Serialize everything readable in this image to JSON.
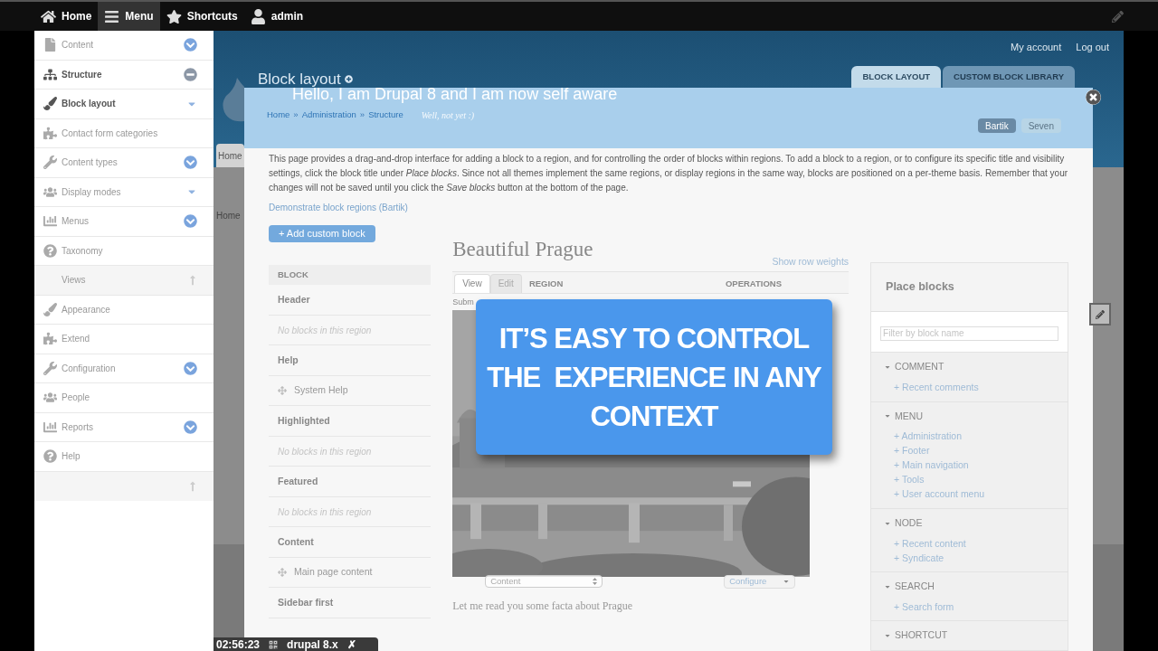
{
  "toolbar": {
    "items": [
      {
        "label": "Home",
        "selected": false
      },
      {
        "label": "Menu",
        "selected": true
      },
      {
        "label": "Shortcuts",
        "selected": false
      },
      {
        "label": "admin",
        "selected": false
      }
    ]
  },
  "sidebar": {
    "items": [
      {
        "label": "Content",
        "selected": false,
        "kind": "circle",
        "expanded": false
      },
      {
        "label": "Structure",
        "selected": true,
        "kind": "circle",
        "expanded": true
      },
      {
        "label": "Block layout",
        "selected": true,
        "kind": "caret",
        "expanded": false
      },
      {
        "label": "Contact form categories",
        "selected": false,
        "kind": "plain"
      },
      {
        "label": "Content types",
        "selected": false,
        "kind": "circle",
        "expanded": false
      },
      {
        "label": "Display modes",
        "selected": false,
        "kind": "caret",
        "expanded": false
      },
      {
        "label": "Menus",
        "selected": false,
        "kind": "circle",
        "expanded": false
      },
      {
        "label": "Taxonomy",
        "selected": false,
        "kind": "plain"
      },
      {
        "label": "Views",
        "selected": false,
        "kind": "up"
      },
      {
        "label": "Appearance",
        "selected": false,
        "kind": "plain"
      },
      {
        "label": "Extend",
        "selected": false,
        "kind": "plain"
      },
      {
        "label": "Configuration",
        "selected": false,
        "kind": "circle",
        "expanded": false
      },
      {
        "label": "People",
        "selected": false,
        "kind": "plain"
      },
      {
        "label": "Reports",
        "selected": false,
        "kind": "circle",
        "expanded": false
      },
      {
        "label": "Help",
        "selected": false,
        "kind": "plain"
      }
    ]
  },
  "header": {
    "account_links": [
      "My account",
      "Log out"
    ],
    "page_title": "Block layout",
    "tabs": [
      {
        "label": "BLOCK LAYOUT",
        "selected": true
      },
      {
        "label": "CUSTOM BLOCK LIBRARY",
        "selected": false
      }
    ],
    "home_tab": "Home",
    "breadcrumb_home": "Home"
  },
  "modal": {
    "title": "Hello, I am Drupal 8 and I am now self aware",
    "subtitle": "Well, not yet :)",
    "breadcrumb": [
      "Home",
      "Administration",
      "Structure"
    ],
    "separator": "»",
    "theme_tabs": [
      {
        "label": "Bartik",
        "selected": true
      },
      {
        "label": "Seven",
        "selected": false
      }
    ],
    "description": "This page provides a drag-and-drop interface for adding a block to a region, and for controlling the order of blocks within regions. To add a block to a region, or to configure its specific title and visibility settings, click the block title under *Place blocks*. Since not all themes implement the same regions, or display regions in the same way, blocks are positioned on a per-theme basis. Remember that your changes will not be saved until you click the *Save blocks* button at the bottom of the page.",
    "demo_link": "Demonstrate block regions (Bartik)",
    "add_button": "+ Add custom block"
  },
  "block_table": {
    "header": "BLOCK",
    "rows": [
      {
        "kind": "region",
        "text": "Header"
      },
      {
        "kind": "empty",
        "text": "No blocks in this region"
      },
      {
        "kind": "region",
        "text": "Help"
      },
      {
        "kind": "block",
        "text": "System Help"
      },
      {
        "kind": "region",
        "text": "Highlighted"
      },
      {
        "kind": "empty",
        "text": "No blocks in this region"
      },
      {
        "kind": "region",
        "text": "Featured"
      },
      {
        "kind": "empty",
        "text": "No blocks in this region"
      },
      {
        "kind": "region",
        "text": "Content"
      },
      {
        "kind": "block",
        "text": "Main page content"
      },
      {
        "kind": "region",
        "text": "Sidebar first"
      }
    ]
  },
  "preview": {
    "title": "Beautiful Prague",
    "weights_link": "Show row weights",
    "tabs": [
      {
        "label": "View",
        "selected": true
      },
      {
        "label": "Edit",
        "selected": false
      }
    ],
    "columns": [
      "REGION",
      "OPERATIONS"
    ],
    "cut_text": "Subm",
    "region_select": "Content",
    "configure_button": "Configure",
    "body": "Let me read you some facta about Prague"
  },
  "place_blocks": {
    "title": "Place blocks",
    "filter_placeholder": "Filter by block name",
    "categories": [
      {
        "name": "COMMENT",
        "expanded": true,
        "items": [
          "+ Recent comments"
        ]
      },
      {
        "name": "MENU",
        "expanded": true,
        "items": [
          "+ Administration",
          "+ Footer",
          "+ Main navigation",
          "+ Tools",
          "+ User account menu"
        ]
      },
      {
        "name": "NODE",
        "expanded": true,
        "items": [
          "+ Recent content",
          "+ Syndicate"
        ]
      },
      {
        "name": "SEARCH",
        "expanded": true,
        "items": [
          "+ Search form"
        ]
      },
      {
        "name": "SHORTCUT",
        "expanded": true
      }
    ]
  },
  "callout": {
    "lines": [
      "IT’S EASY TO CONTROL",
      "THE  EXPERIENCE IN ANY",
      "CONTEXT"
    ]
  },
  "video_bar": {
    "time": "02:56:23",
    "label": "drupal 8.x",
    "close": "✗"
  }
}
